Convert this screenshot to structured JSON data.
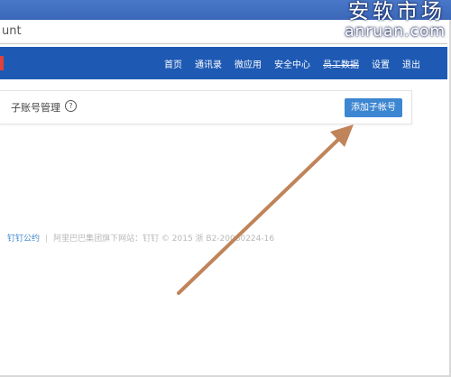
{
  "browser": {
    "address_text": "unt"
  },
  "watermark": {
    "line1": "安软市场",
    "line2": "anruan.com"
  },
  "nav": {
    "items": [
      {
        "label": "首页"
      },
      {
        "label": "通讯录"
      },
      {
        "label": "微应用"
      },
      {
        "label": "安全中心"
      },
      {
        "label": "员工数据"
      },
      {
        "label": "设置"
      },
      {
        "label": "退出"
      }
    ]
  },
  "panel": {
    "title": "子账号管理",
    "help_glyph": "?",
    "add_button_label": "添加子帐号"
  },
  "footer": {
    "link_label": "钉钉公约",
    "separator": "|",
    "text": "阿里巴巴集团旗下网站：钉钉 © 2015 浙 B2-20080224-16"
  },
  "colors": {
    "nav_bg": "#1e5ab4",
    "button_bg": "#3d86d1",
    "arrow": "#c0845a"
  }
}
